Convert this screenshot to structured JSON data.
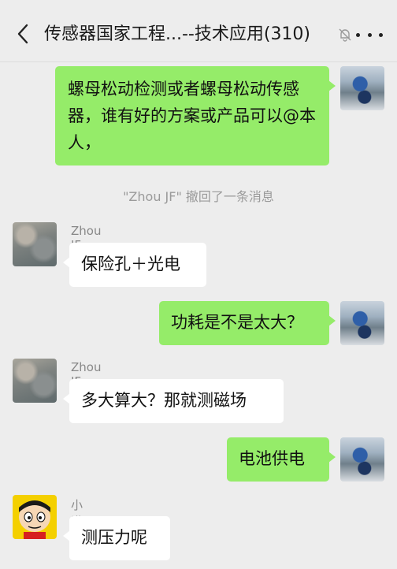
{
  "header": {
    "title": "传感器国家工程...--技术应用(310)",
    "icons": {
      "back": "chevron-left-icon",
      "mute": "bell-off-icon",
      "more": "more-dots-icon"
    }
  },
  "messages": [
    {
      "type": "outgoing",
      "text": "螺母松动检测或者螺母松动传感器，谁有好的方案或产品可以@本人，",
      "avatar": "outdoor-photo"
    },
    {
      "type": "system",
      "text": "\"Zhou JF\" 撤回了一条消息"
    },
    {
      "type": "incoming",
      "sender": "Zhou JF",
      "text": "保险孔＋光电",
      "avatar": "aerial-photo"
    },
    {
      "type": "outgoing",
      "text": "功耗是不是太大？",
      "avatar": "outdoor-photo"
    },
    {
      "type": "incoming",
      "sender": "Zhou JF",
      "text": "多大算大？那就测磁场",
      "avatar": "aerial-photo"
    },
    {
      "type": "outgoing",
      "text": "电池供电",
      "avatar": "outdoor-photo"
    },
    {
      "type": "incoming",
      "sender": "小满",
      "text": "测压力呢",
      "avatar": "cartoon-face"
    }
  ],
  "colors": {
    "outgoing_bubble": "#95ec69",
    "incoming_bubble": "#ffffff",
    "background": "#ededed"
  }
}
